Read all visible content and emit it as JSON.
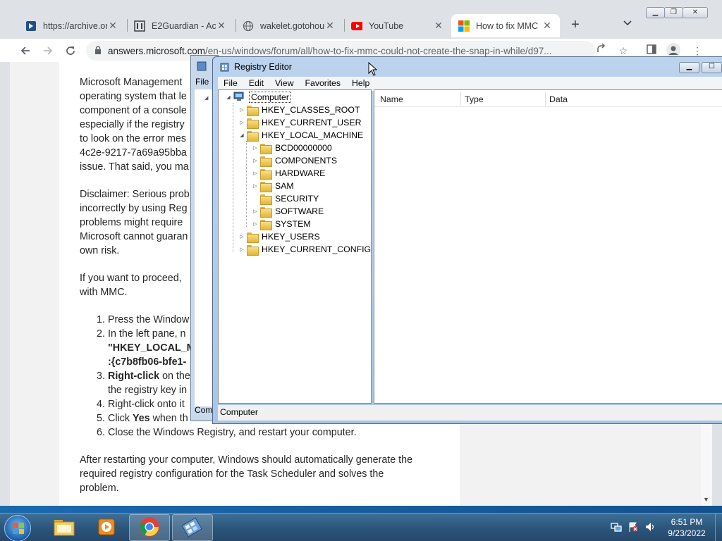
{
  "desktop": {
    "edge_letter_1": "M",
    "edge_letter_2": "D"
  },
  "chrome": {
    "tabs": [
      {
        "title": "https://archive.or",
        "icon": "archive-icon"
      },
      {
        "title": "E2Guardian - Acc",
        "icon": "e2guardian-icon"
      },
      {
        "title": "wakelet.gotohou",
        "icon": "globe-icon"
      },
      {
        "title": "YouTube",
        "icon": "youtube-icon"
      },
      {
        "title": "How to fix MMC",
        "icon": "microsoft-icon"
      }
    ],
    "url_host": "answers.microsoft.com",
    "url_path": "/en-us/windows/forum/all/how-to-fix-mmc-could-not-create-the-snap-in-while/d97..."
  },
  "article": {
    "p1": [
      "Microsoft Management",
      "operating system that le",
      "component of a console",
      "especially if the registry",
      "to look on the error mes",
      "4c2e-9217-7a69a95bba",
      "issue. That said, you ma"
    ],
    "p2": [
      "Disclaimer: Serious prob",
      "incorrectly by using Reg",
      "problems might require",
      "Microsoft cannot guaran",
      "own risk."
    ],
    "p3": [
      "If you want to proceed,",
      "with MMC."
    ],
    "steps": [
      {
        "num": "1.",
        "text": "Press the Window"
      },
      {
        "num": "2.",
        "text": "In the left pane, n",
        "line2": "\"HKEY_LOCAL_M",
        "line3": ":{c7b8fb06-bfe1-"
      },
      {
        "num": "3.",
        "bold": "Right-click",
        "text": " on the",
        "line2": "the registry key in"
      },
      {
        "num": "4.",
        "text": "Right-click onto it"
      },
      {
        "num": "5.",
        "text_pre": "Click ",
        "bold": "Yes",
        "text": " when th"
      },
      {
        "num": "6.",
        "text": "Close the Windows Registry, and restart your computer."
      }
    ],
    "p4": [
      "After restarting your computer, Windows should automatically generate the",
      "required registry configuration for the Task Scheduler and solves the",
      "problem."
    ]
  },
  "back_window": {
    "menu_file": "File",
    "status_prefix": "Com"
  },
  "regedit": {
    "title": "Registry Editor",
    "menu": [
      "File",
      "Edit",
      "View",
      "Favorites",
      "Help"
    ],
    "columns": [
      "Name",
      "Type",
      "Data"
    ],
    "status": "Computer",
    "tree": {
      "root": "Computer",
      "hives": [
        "HKEY_CLASSES_ROOT",
        "HKEY_CURRENT_USER",
        "HKEY_LOCAL_MACHINE"
      ],
      "hklm_children": [
        "BCD00000000",
        "COMPONENTS",
        "HARDWARE",
        "SAM",
        "SECURITY",
        "SOFTWARE",
        "SYSTEM"
      ],
      "hives_after": [
        "HKEY_USERS",
        "HKEY_CURRENT_CONFIG"
      ]
    }
  },
  "taskbar": {
    "apps": [
      "explorer-icon",
      "media-player-icon",
      "chrome-icon",
      "regedit-icon"
    ],
    "time": "6:51 PM",
    "date": "9/23/2022"
  }
}
